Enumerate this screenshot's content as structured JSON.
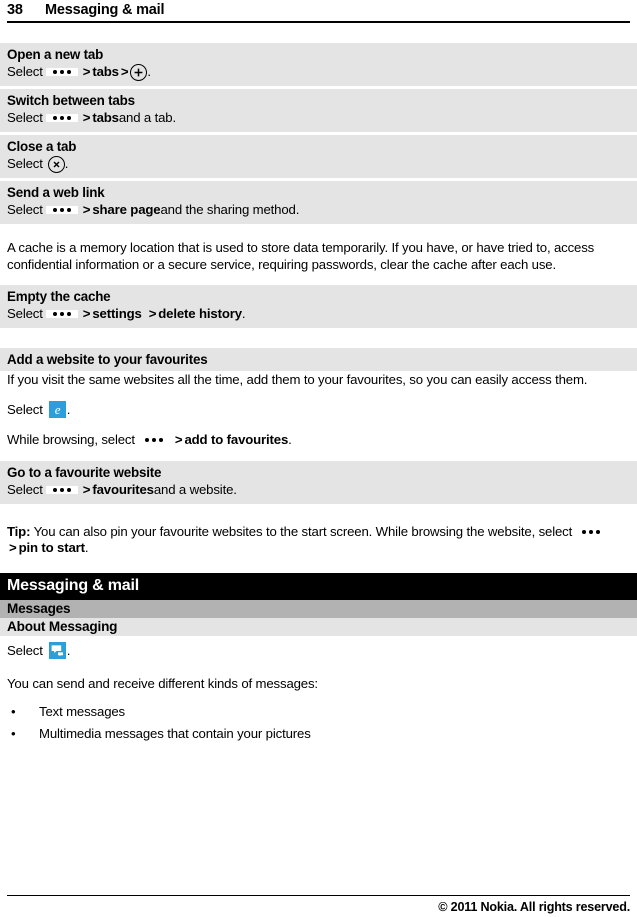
{
  "running_header": {
    "page_number": "38",
    "chapter_title": "Messaging & mail"
  },
  "steps": [
    {
      "heading": "Open a new tab",
      "prefix": "Select",
      "menu_icon": "overflow-dots-icon",
      "sep1": ">",
      "cmd1": "tabs",
      "sep2": ">",
      "glyph": "plus-circle-icon",
      "suffix": "."
    },
    {
      "heading": "Switch between tabs",
      "prefix": "Select",
      "menu_icon": "overflow-dots-icon",
      "sep1": ">",
      "cmd1": "tabs",
      "suffix": " and a tab."
    },
    {
      "heading": "Close a tab",
      "prefix": "Select",
      "glyph": "close-circle-icon",
      "suffix": "."
    },
    {
      "heading": "Send a web link",
      "prefix": "Select",
      "menu_icon": "overflow-dots-icon",
      "sep1": ">",
      "cmd1": "share page",
      "suffix": " and the sharing method."
    }
  ],
  "cache_paragraph": "A cache is a memory location that is used to store data temporarily. If you have, or have tried to, access confidential information or a secure service, requiring passwords, clear the cache after each use.",
  "empty_cache": {
    "heading": "Empty the cache",
    "prefix": "Select",
    "menu_icon": "overflow-dots-icon",
    "sep1": ">",
    "cmd1": "settings",
    "sep2": ">",
    "cmd2": "delete history",
    "suffix": "."
  },
  "favourites": {
    "heading": "Add a website to your favourites",
    "intro": "If you visit the same websites all the time, add them to your favourites, so you can easily access them.",
    "select_prefix": "Select",
    "browser_icon": "internet-explorer-icon",
    "select_suffix": ".",
    "browse_prefix": "While browsing, select",
    "menu_icon": "overflow-dots-icon",
    "sep1": ">",
    "cmd1": "add to favourites",
    "browse_suffix": "."
  },
  "goto_favourite": {
    "heading": "Go to a favourite website",
    "prefix": "Select",
    "menu_icon": "overflow-dots-icon",
    "sep1": ">",
    "cmd1": "favourites",
    "suffix": " and a website."
  },
  "tip": {
    "label": "Tip:",
    "text_before": " You can also pin your favourite websites to the start screen. While browsing the website, select",
    "menu_icon": "overflow-dots-icon",
    "sep1": ">",
    "cmd1": "pin to start",
    "text_after": "."
  },
  "chapter_bar": {
    "title": "Messaging & mail"
  },
  "section_1": "Messages",
  "section_2": "About Messaging",
  "messaging": {
    "select_prefix": "Select",
    "app_icon": "messaging-app-icon",
    "select_suffix": ".",
    "intro": "You can send and receive different kinds of messages:",
    "bullet_char": "•",
    "bullets": [
      "Text messages",
      "Multimedia messages that contain your pictures"
    ]
  },
  "footer": {
    "copyright": "© 2011 Nokia. All rights reserved."
  },
  "colors": {
    "band_gray": "#e4e4e4",
    "section_gray": "#b2b2b2",
    "chapter_black": "#000000",
    "ie_blue": "#2b9fd9",
    "msg_blue": "#2b9fd9"
  }
}
